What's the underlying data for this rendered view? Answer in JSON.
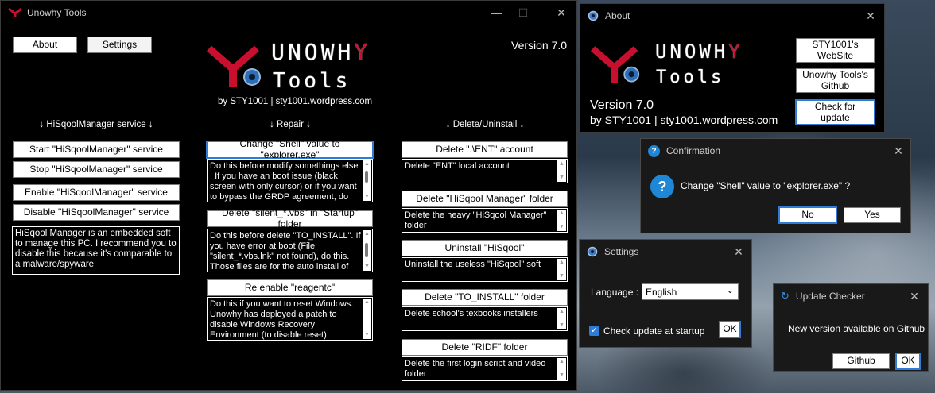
{
  "main": {
    "title": "Unowhy Tools",
    "about_label": "About",
    "settings_label": "Settings",
    "version": "Version 7.0",
    "logo": {
      "top": "UNOWH",
      "top_accent": "Y",
      "bottom": "Tools"
    },
    "byline": "by STY1001 | sty1001.wordpress.com",
    "sections": {
      "service": "↓ HiSqoolManager service ↓",
      "repair": "↓ Repair ↓",
      "delete": "↓ Delete/Uninstall ↓"
    },
    "service_buttons": [
      "Start \"HiSqoolManager\" service",
      "Stop \"HiSqoolManager\" service",
      "Enable \"HiSqoolManager\" service",
      "Disable \"HiSqoolManager\" service"
    ],
    "service_desc": "HiSqool Manager is an embedded soft to manage this PC. I recommend you to disable this because it's comparable to a malware/spyware",
    "repair": [
      {
        "label": "Change \"Shell\" value to \"explorer.exe\"",
        "desc": "Do this before modify somethings else ! If you have an boot issue (black screen with only cursor) or if you want to bypass the GRDP agreement, do this"
      },
      {
        "label": "Delete \"silent_*.vbs\" in \"Startup\" folder",
        "desc": "Do this before delete \"TO_INSTALL\". If you have error at boot (File \"silent_*.vbs.lnk\" not found), do this. Those files are for the auto install of"
      },
      {
        "label": "Re enable \"reagentc\"",
        "desc": "Do this if you want to reset Windows. Unowhy has deployed a patch to disable Windows Recovery Environment (to disable reset)"
      }
    ],
    "delete": [
      {
        "label": "Delete \".\\ENT\" account",
        "desc": "Delete \"ENT\" local account"
      },
      {
        "label": "Delete \"HiSqool Manager\" folder",
        "desc": "Delete the heavy \"HiSqool Manager\" folder"
      },
      {
        "label": "Uninstall \"HiSqool\"",
        "desc": "Uninstall the useless \"HiSqool\" soft"
      },
      {
        "label": "Delete \"TO_INSTALL\" folder",
        "desc": "Delete school's texbooks installers"
      },
      {
        "label": "Delete \"RIDF\" folder",
        "desc": "Delete the first login script and video folder"
      }
    ]
  },
  "about": {
    "title": "About",
    "version": "Version 7.0",
    "byline": "by STY1001 | sty1001.wordpress.com",
    "website_label": "STY1001's WebSite",
    "github_label": "Unowhy Tools's Github",
    "update_label": "Check for update"
  },
  "confirm": {
    "title": "Confirmation",
    "message": "Change \"Shell\" value to \"explorer.exe\" ?",
    "no_label": "No",
    "yes_label": "Yes"
  },
  "settings": {
    "title": "Settings",
    "language_label": "Language :",
    "language_value": "English",
    "check_label": "Check update at startup",
    "check_checked": true,
    "ok_label": "OK"
  },
  "updater": {
    "title": "Update Checker",
    "message": "New version available on Github",
    "github_label": "Github",
    "ok_label": "OK"
  },
  "colors": {
    "accent": "#c8102e",
    "focus": "#2f7bd5",
    "info": "#1e88d6"
  }
}
